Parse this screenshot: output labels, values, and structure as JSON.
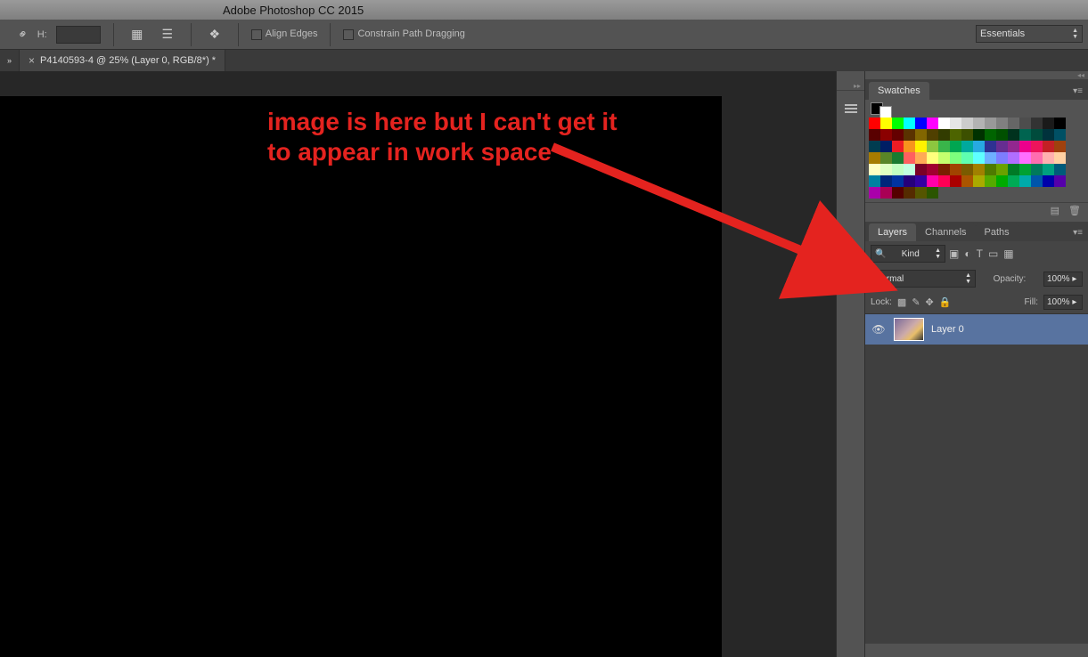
{
  "app": {
    "title": "Adobe Photoshop CC 2015"
  },
  "optbar": {
    "h_label": "H:",
    "align_edges": "Align Edges",
    "constrain": "Constrain Path Dragging"
  },
  "workspace_selector": "Essentials",
  "document_tab": {
    "title": "P4140593-4 @ 25% (Layer 0, RGB/8*) *"
  },
  "panels": {
    "swatches": {
      "tab": "Swatches",
      "fg": "#000000",
      "bg": "#ffffff"
    },
    "layers": {
      "tabs": [
        "Layers",
        "Channels",
        "Paths"
      ],
      "filter_label": "Kind",
      "blend_mode": "Normal",
      "opacity_label": "Opacity:",
      "opacity_value": "100%",
      "lock_label": "Lock:",
      "fill_label": "Fill:",
      "fill_value": "100%",
      "layer0": {
        "name": "Layer 0"
      }
    }
  },
  "annotation": {
    "line1": "image is here but I can't get it",
    "line2": "to appear in work space"
  },
  "swatch_colors": [
    "#ff0000",
    "#ffff00",
    "#00ff00",
    "#00ffff",
    "#0000ff",
    "#ff00ff",
    "#ffffff",
    "#e6e6e6",
    "#cccccc",
    "#b3b3b3",
    "#999999",
    "#808080",
    "#666666",
    "#4d4d4d",
    "#333333",
    "#1a1a1a",
    "#000000",
    "#590000",
    "#8b0000",
    "#640000",
    "#5a3200",
    "#826600",
    "#504000",
    "#323c00",
    "#4d6400",
    "#3c5000",
    "#003200",
    "#006400",
    "#005000",
    "#00321e",
    "#006450",
    "#004b3c",
    "#00323c",
    "#005064",
    "#003c50",
    "#001e64",
    "#ed1c24",
    "#f7941d",
    "#fff200",
    "#8dc63f",
    "#39b54a",
    "#00a651",
    "#00a99d",
    "#27aae1",
    "#2e3192",
    "#662d91",
    "#92278f",
    "#ec008c",
    "#ed145b",
    "#c32025",
    "#a0410d",
    "#a67c00",
    "#598527",
    "#1a7b30",
    "#ff5f5f",
    "#ffaa56",
    "#ffff7d",
    "#c4ff6e",
    "#7dff7d",
    "#5fffb0",
    "#5fffff",
    "#6eb0ff",
    "#7d7dff",
    "#b06eff",
    "#ff6eff",
    "#ff6eb0",
    "#ffb0b0",
    "#ffd1a3",
    "#ffffc2",
    "#e0ffc2",
    "#c2ffc2",
    "#c2ffe0",
    "#7a0026",
    "#a1002f",
    "#7a1f00",
    "#a14400",
    "#7a5b00",
    "#a18000",
    "#4e7a00",
    "#6aa100",
    "#007a26",
    "#00a133",
    "#007a5b",
    "#00a180",
    "#005b7a",
    "#0080a1",
    "#00267a",
    "#0033a1",
    "#26007a",
    "#3300a1",
    "#ff00aa",
    "#ff0055",
    "#aa0000",
    "#aa5500",
    "#aaaa00",
    "#55aa00",
    "#00aa00",
    "#00aa55",
    "#00aaaa",
    "#0055aa",
    "#0000aa",
    "#5500aa",
    "#aa00aa",
    "#aa0055",
    "#550000",
    "#552b00",
    "#555500",
    "#2b5500"
  ]
}
